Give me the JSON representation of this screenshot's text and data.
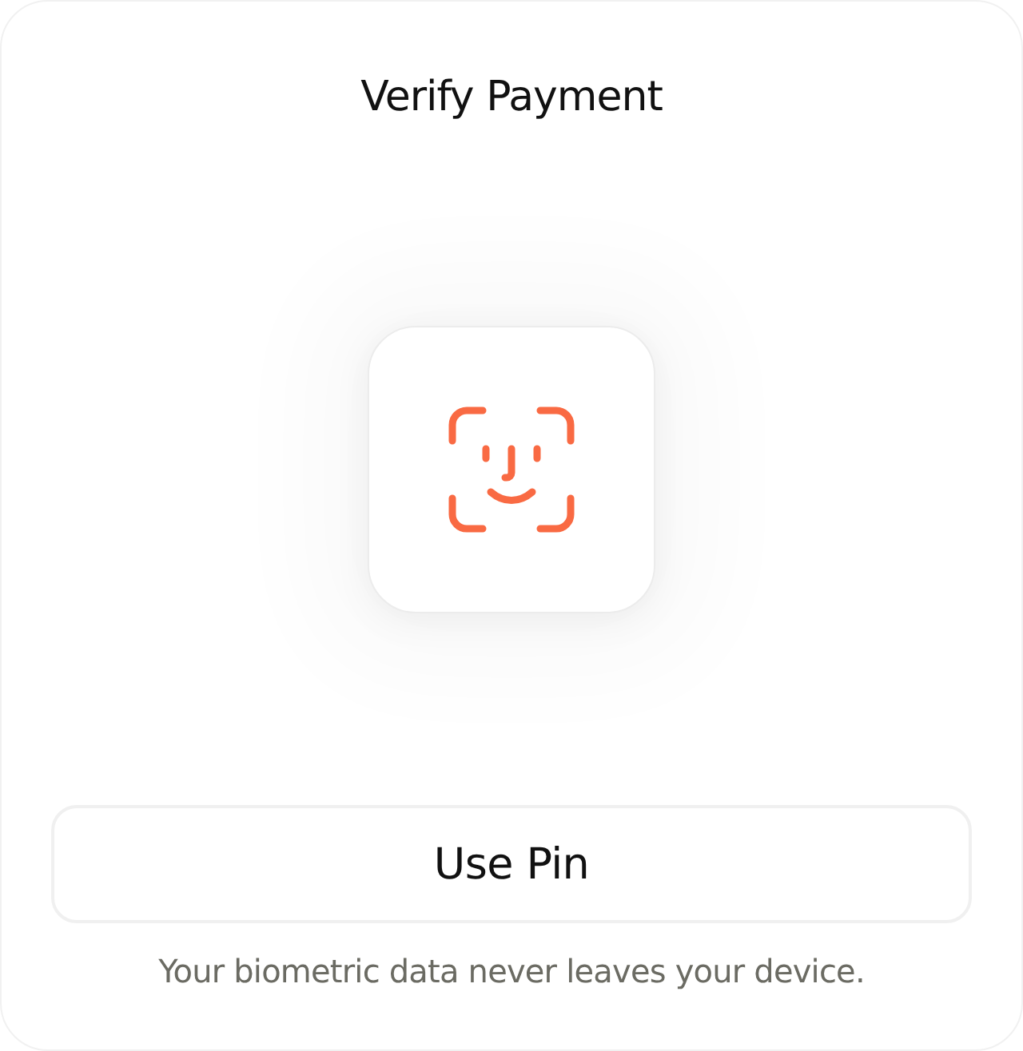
{
  "title": "Verify Payment",
  "button": {
    "label": "Use Pin"
  },
  "note": "Your biometric data never leaves your device."
}
